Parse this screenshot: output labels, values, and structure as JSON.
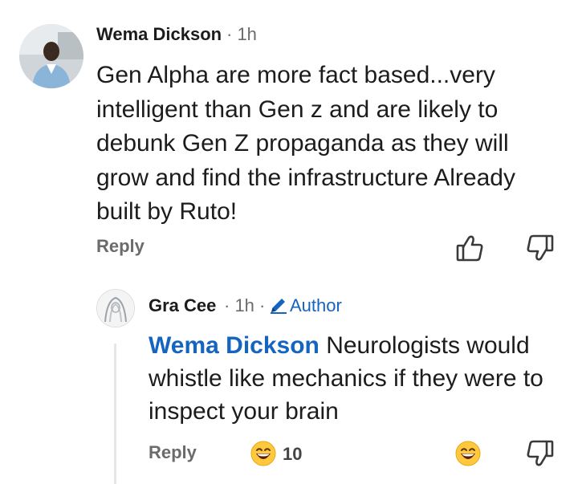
{
  "comment": {
    "author": "Wema Dickson",
    "time": "· 1h",
    "text": "Gen Alpha are more fact based...very intelligent than Gen z and are likely to debunk Gen Z propaganda as they will grow and find the infrastructure Already built by Ruto!",
    "reply_label": "Reply",
    "icons": {
      "like": "thumbs-up-icon",
      "dislike": "thumbs-down-icon"
    }
  },
  "reply": {
    "author": "Gra Cee",
    "time": "· 1h ·",
    "badge": "Author",
    "mention": "Wema Dickson",
    "text": " Neurologists would whistle like mechanics if they were to inspect your brain",
    "reply_label": "Reply",
    "reaction_count": "10",
    "icons": {
      "reaction": "grin-emoji-icon",
      "react": "grin-emoji-icon",
      "dislike": "thumbs-down-icon",
      "badge": "pencil-icon"
    }
  },
  "colors": {
    "accent": "#1565c0",
    "muted": "#6b6b6b",
    "text": "#1c1c1c",
    "emoji": "#ffc83d"
  }
}
